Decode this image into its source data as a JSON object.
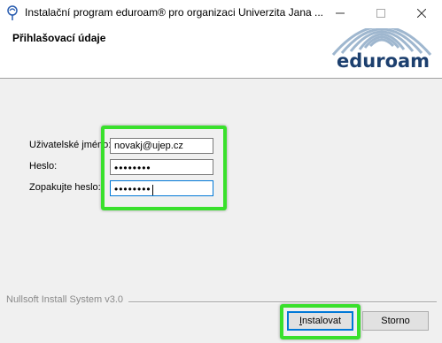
{
  "window": {
    "title": "Instalační program eduroam® pro organizaci Univerzita Jana ...",
    "icons": {
      "app": "installer-icon",
      "minimize": "minimize-icon",
      "maximize": "maximize-icon",
      "close": "close-icon"
    }
  },
  "header": {
    "title": "Přihlašovací údaje",
    "logo_text": "eduroam",
    "logo_colors": {
      "edu": "#1c3f6e",
      "roam": "#1c3f6e",
      "waves": "#9fb7cf"
    }
  },
  "form": {
    "username": {
      "label": "Uživatelské jméno:",
      "value": "novakj@ujep.cz"
    },
    "password": {
      "label": "Heslo:",
      "value": "••••••••"
    },
    "password_confirm": {
      "label": "Zopakujte heslo:",
      "value": "••••••••"
    }
  },
  "footer": {
    "branding": "Nullsoft Install System v3.0",
    "install_label": "Instalovat",
    "cancel_label": "Storno"
  },
  "colors": {
    "highlight": "#39e02c",
    "focus": "#0078d7"
  }
}
